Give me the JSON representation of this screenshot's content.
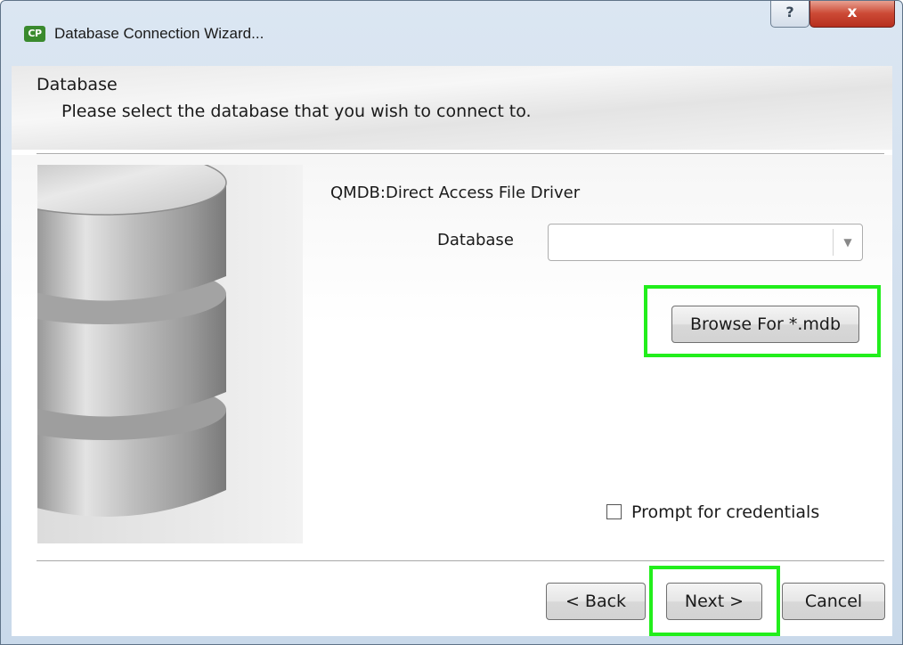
{
  "window": {
    "title": "Database Connection Wizard...",
    "app_icon_text": "CP",
    "help_symbol": "?",
    "close_symbol": "x"
  },
  "header": {
    "title": "Database",
    "subtitle": "Please select the database that you wish to connect to."
  },
  "main": {
    "image": "database-cylinder-graphic",
    "driver_label": "QMDB:Direct Access File Driver",
    "database_label": "Database",
    "database_value": "",
    "browse_button": "Browse For *.mdb",
    "prompt_credentials_label": "Prompt for credentials",
    "prompt_credentials_checked": false
  },
  "footer": {
    "back_button": "< Back",
    "next_button": "Next >",
    "cancel_button": "Cancel"
  },
  "colors": {
    "highlight": "#22ee1c",
    "close_button": "#c94431",
    "window_frame": "#c9d9ea"
  }
}
